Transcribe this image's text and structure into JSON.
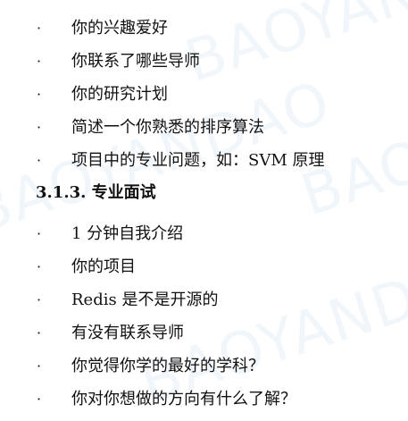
{
  "watermark": {
    "text": "BAOYANDAO",
    "color": "#78aadc"
  },
  "list_a": [
    "你的兴趣爱好",
    "你联系了哪些导师",
    "你的研究计划",
    "简述一个你熟悉的排序算法",
    "项目中的专业问题，如：SVM 原理"
  ],
  "section_heading": "3.1.3.  专业面试",
  "list_b": [
    "1 分钟自我介绍",
    "你的项目",
    "Redis 是不是开源的",
    "有没有联系导师",
    "你觉得你学的最好的学科？",
    "你对你想做的方向有什么了解？"
  ],
  "bullet_glyph": "·"
}
